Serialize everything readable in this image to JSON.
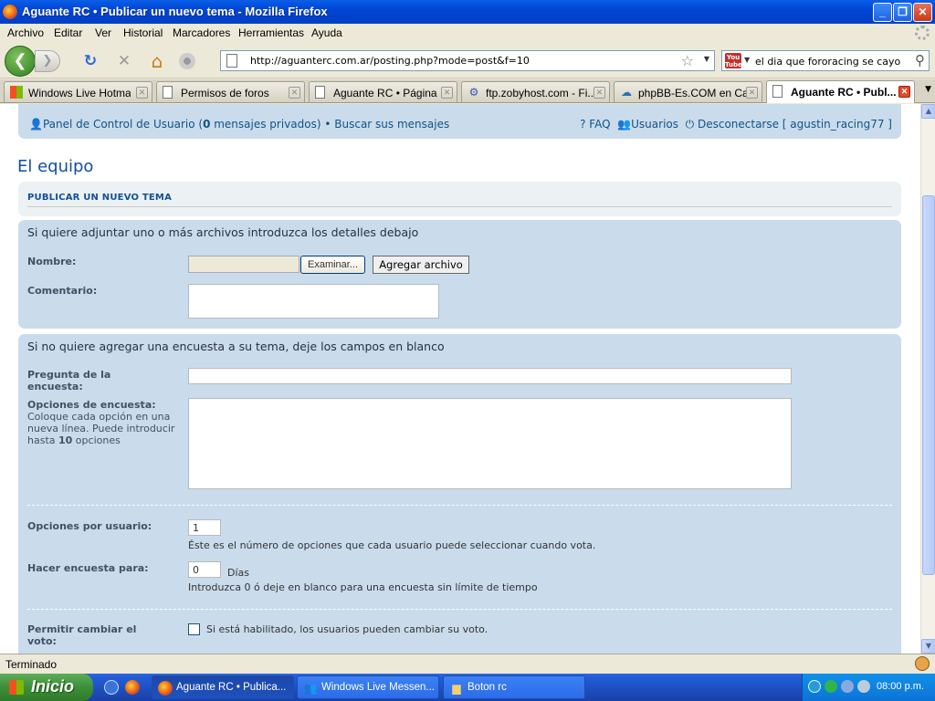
{
  "window": {
    "title": "Aguante RC • Publicar un nuevo tema - Mozilla Firefox",
    "min_glyph": "_",
    "max_glyph": "❐",
    "close_glyph": "✕"
  },
  "menu": [
    "Archivo",
    "Editar",
    "Ver",
    "Historial",
    "Marcadores",
    "Herramientas",
    "Ayuda"
  ],
  "nav": {
    "back_glyph": "❮",
    "forward_glyph": "❯",
    "reload_glyph": "↻",
    "stop_glyph": "✕",
    "home_glyph": "⌂",
    "url": "http://aguanterc.com.ar/posting.php?mode=post&f=10",
    "star_glyph": "☆",
    "search_value": "el dia que fororacing se cayo",
    "search_engine_icon": "youtube-icon",
    "youtube_mark": "You Tube"
  },
  "tabs": [
    {
      "label": "Windows Live Hotmail",
      "icon": "windows-flag-icon",
      "active": false
    },
    {
      "label": "Permisos de foros",
      "icon": "page-icon",
      "active": false
    },
    {
      "label": "Aguante RC • Página ...",
      "icon": "page-icon",
      "active": false
    },
    {
      "label": "ftp.zobyhost.com - Fi...",
      "icon": "ftp-icon",
      "active": false
    },
    {
      "label": "phpBB-Es.COM en Ca...",
      "icon": "phpbb-icon",
      "active": false
    },
    {
      "label": "Aguante RC • Publ...",
      "icon": "page-icon",
      "active": true
    }
  ],
  "forum_nav": {
    "ucp_prefix": "Panel de Control de Usuario (",
    "pm_count": "0",
    "ucp_suffix": " mensajes privados)",
    "separator": " • ",
    "search_posts": "Buscar sus mensajes",
    "faq": "FAQ",
    "members": "Usuarios",
    "logout": "Desconectarse [ agustin_racing77 ]"
  },
  "heading": "El equipo",
  "post_header": "PUBLICAR UN NUEVO TEMA",
  "attach": {
    "intro": "Si quiere adjuntar uno o más archivos introduzca los detalles debajo",
    "name_label": "Nombre:",
    "browse_button": "Examinar...",
    "add_file_button": "Agregar archivo",
    "comment_label": "Comentario:"
  },
  "poll": {
    "intro": "Si no quiere agregar una encuesta a su tema, deje los campos en blanco",
    "question_label": "Pregunta de la encuesta:",
    "options_label": "Opciones de encuesta:",
    "options_desc_1": "Coloque cada opción en una nueva línea. Puede introducir hasta ",
    "options_desc_max": "10",
    "options_desc_2": " opciones",
    "per_user_label": "Opciones por usuario:",
    "per_user_value": "1",
    "per_user_note": "Éste es el número de opciones que cada usuario puede seleccionar cuando vota.",
    "duration_label": "Hacer encuesta para:",
    "duration_value": "0",
    "duration_unit": "Días",
    "duration_note": "Introduzca 0 ó deje en blanco para una encuesta sin límite de tiempo",
    "change_vote_label": "Permitir cambiar el voto:",
    "change_vote_note": "Si está habilitado, los usuarios pueden cambiar su voto."
  },
  "status": "Terminado",
  "taskbar": {
    "start": "Inicio",
    "tasks": [
      {
        "label": "Aguante RC • Publica...",
        "icon": "firefox-icon",
        "active": true
      },
      {
        "label": "Windows Live Messen...",
        "icon": "messenger-icon",
        "active": false
      },
      {
        "label": "Boton rc",
        "icon": "folder-icon",
        "active": false
      }
    ],
    "clock": "08:00 p.m."
  }
}
